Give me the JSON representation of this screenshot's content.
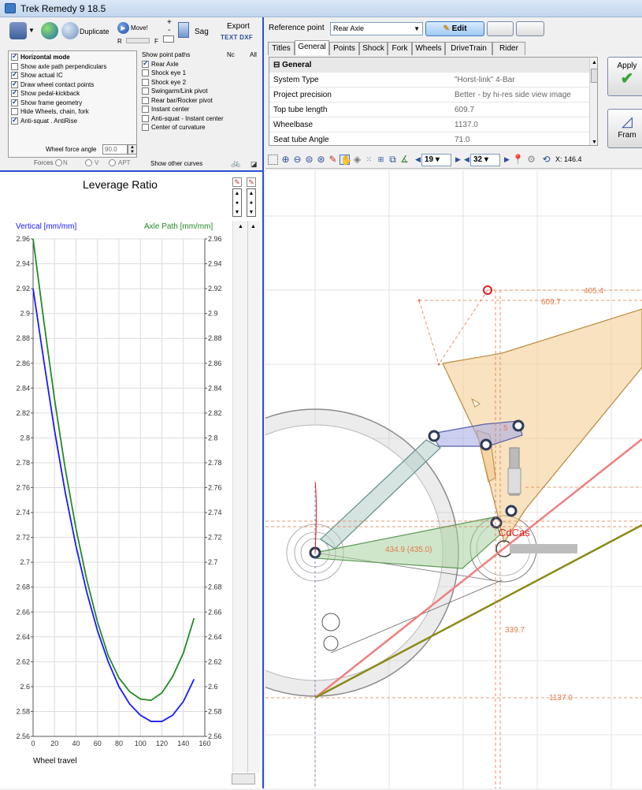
{
  "window": {
    "title": "Trek Remedy 9 18.5"
  },
  "toolbar_left": {
    "duplicate_label": "Duplicate",
    "move_label": "Move!",
    "sag_label": "Sag",
    "export_label": "Export",
    "export_formats": "TEXT DXF",
    "plus": "+",
    "minus": "-",
    "r_label": "R",
    "f_label": "F"
  },
  "options": [
    {
      "label": "Horizontal mode",
      "checked": true,
      "bold": true
    },
    {
      "label": "Show axle path perpendiculars",
      "checked": false
    },
    {
      "label": "Show actual IC",
      "checked": true
    },
    {
      "label": "Draw wheel contact points",
      "checked": true
    },
    {
      "label": "Show pedal-kickback",
      "checked": true
    },
    {
      "label": "Show frame geometry",
      "checked": true
    },
    {
      "label": "Hide Wheels, chain, fork",
      "checked": false
    },
    {
      "label": "Anti-squat . AntiRise",
      "checked": true
    }
  ],
  "point_paths": {
    "header": "Show point paths",
    "nc": "Nc",
    "all": "All",
    "items": [
      {
        "label": "Rear Axle",
        "checked": true
      },
      {
        "label": "Shock eye 1",
        "checked": false
      },
      {
        "label": "Shock eye 2",
        "checked": false
      },
      {
        "label": "Swingarm/Link pivot",
        "checked": false
      },
      {
        "label": "Rear bar/Rocker pivot",
        "checked": false
      },
      {
        "label": "Instant center",
        "checked": false
      },
      {
        "label": "Anti-squat - Instant center",
        "checked": false
      },
      {
        "label": "Center of curvature",
        "checked": false
      }
    ]
  },
  "wheel_force": {
    "label": "Wheel force angle",
    "value": "90.0"
  },
  "forces": {
    "label": "Forces",
    "n": "N",
    "v": "V",
    "apt": "APT"
  },
  "show_other_curves": "Show other curves",
  "reference": {
    "label": "Reference point",
    "value": "Rear Axle",
    "edit_label": "Edit"
  },
  "tabs": [
    "Titles",
    "General",
    "Points",
    "Shock",
    "Fork",
    "Wheels",
    "DriveTrain",
    "Rider"
  ],
  "active_tab": "General",
  "properties": {
    "category": "General",
    "rows": [
      {
        "key": "System Type",
        "value": "\"Horst-link\" 4-Bar"
      },
      {
        "key": "Project precision",
        "value": "Better - by hi-res side view image"
      },
      {
        "key": "Top tube length",
        "value": "609.7"
      },
      {
        "key": "Wheelbase",
        "value": "1137.0"
      },
      {
        "key": "Seat tube Angle",
        "value": "71.0"
      }
    ]
  },
  "side_buttons": {
    "apply": "Apply",
    "frame": "Fram"
  },
  "view_toolbar": {
    "spin1": "19",
    "spin2": "32",
    "coord": "X: 146.4"
  },
  "chart_data": {
    "type": "line",
    "title": "Leverage Ratio",
    "left_axis_label": "Vertical [mm/mm]",
    "right_axis_label": "Axle Path [mm/mm]",
    "xlabel": "Wheel travel",
    "xlim": [
      0,
      160
    ],
    "ylim": [
      2.56,
      2.96
    ],
    "x_ticks": [
      0,
      20,
      40,
      60,
      80,
      100,
      120,
      140,
      160
    ],
    "y_ticks": [
      2.56,
      2.58,
      2.6,
      2.62,
      2.64,
      2.66,
      2.68,
      2.7,
      2.72,
      2.74,
      2.76,
      2.78,
      2.8,
      2.82,
      2.84,
      2.86,
      2.88,
      2.9,
      2.92,
      2.94,
      2.96
    ],
    "colors": {
      "vertical": "#1a1aff",
      "axle": "#228b22"
    },
    "series": [
      {
        "name": "Vertical [mm/mm]",
        "color": "#1a1aff",
        "x": [
          0,
          10,
          20,
          30,
          40,
          50,
          60,
          70,
          80,
          90,
          100,
          110,
          120,
          130,
          140,
          150
        ],
        "y": [
          2.92,
          2.862,
          2.806,
          2.756,
          2.713,
          2.676,
          2.645,
          2.62,
          2.6,
          2.586,
          2.577,
          2.572,
          2.572,
          2.577,
          2.588,
          2.606
        ]
      },
      {
        "name": "Axle Path [mm/mm]",
        "color": "#228b22",
        "x": [
          0,
          10,
          20,
          30,
          40,
          50,
          60,
          70,
          80,
          90,
          100,
          110,
          120,
          130,
          140,
          150
        ],
        "y": [
          2.96,
          2.894,
          2.831,
          2.775,
          2.727,
          2.686,
          2.652,
          2.625,
          2.607,
          2.596,
          2.59,
          2.589,
          2.595,
          2.608,
          2.627,
          2.655
        ]
      }
    ]
  },
  "drawing": {
    "dim_top_tube": "609.7",
    "dim_reach": "405.4",
    "dim_chainstay": "434.9 (435.0)",
    "dim_stack": "339.7",
    "dim_wheelbase": "1137.0",
    "label_shock": "5",
    "label_cdcas": "CdCas"
  }
}
